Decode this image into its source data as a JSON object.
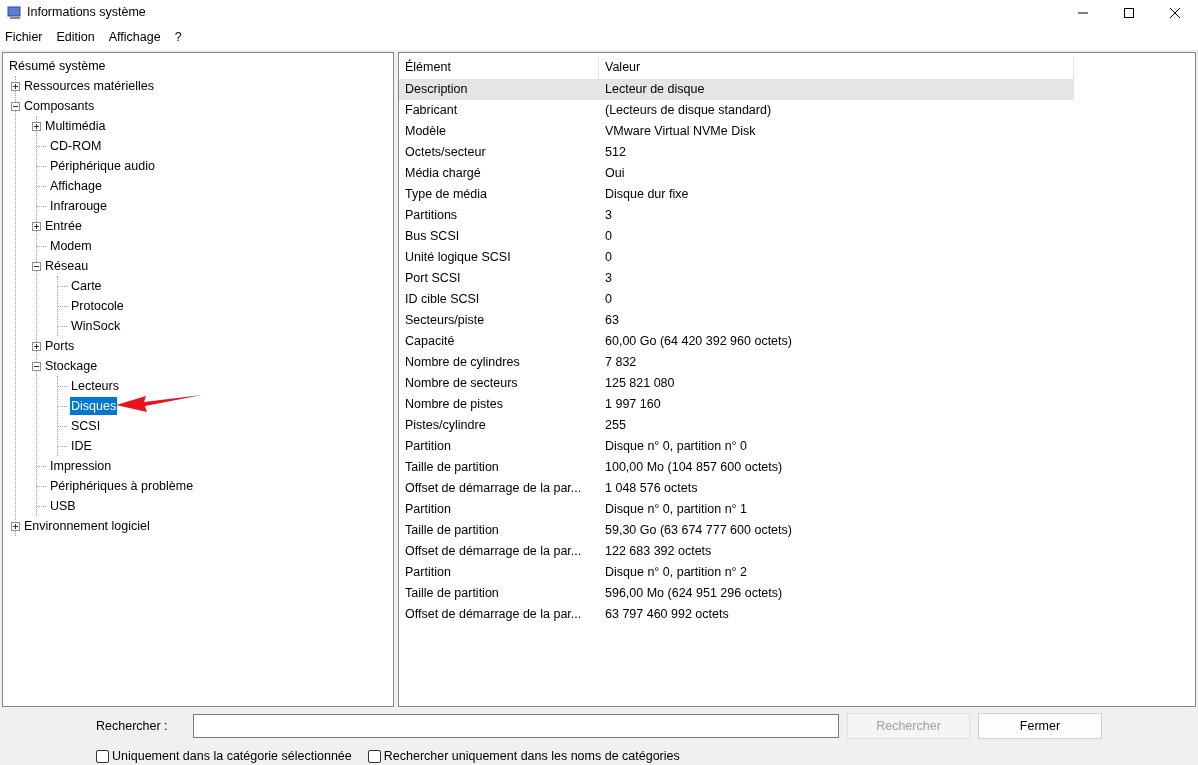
{
  "window": {
    "title": "Informations système"
  },
  "menu": [
    "Fichier",
    "Edition",
    "Affichage",
    "?"
  ],
  "tree": [
    {
      "label": "Résumé système",
      "selected": false,
      "children": [
        {
          "label": "Ressources matérielles",
          "selected": false,
          "expanded": false
        },
        {
          "label": "Composants",
          "selected": false,
          "expanded": true,
          "children": [
            {
              "label": "Multimédia",
              "selected": false,
              "expanded": false
            },
            {
              "label": "CD-ROM",
              "selected": false
            },
            {
              "label": "Périphérique audio",
              "selected": false
            },
            {
              "label": "Affichage",
              "selected": false
            },
            {
              "label": "Infrarouge",
              "selected": false
            },
            {
              "label": "Entrée",
              "selected": false,
              "expanded": false
            },
            {
              "label": "Modem",
              "selected": false
            },
            {
              "label": "Réseau",
              "selected": false,
              "expanded": true,
              "children": [
                {
                  "label": "Carte",
                  "selected": false
                },
                {
                  "label": "Protocole",
                  "selected": false
                },
                {
                  "label": "WinSock",
                  "selected": false
                }
              ]
            },
            {
              "label": "Ports",
              "selected": false,
              "expanded": false
            },
            {
              "label": "Stockage",
              "selected": false,
              "expanded": true,
              "children": [
                {
                  "label": "Lecteurs",
                  "selected": false
                },
                {
                  "label": "Disques",
                  "selected": true
                },
                {
                  "label": "SCSI",
                  "selected": false
                },
                {
                  "label": "IDE",
                  "selected": false
                }
              ]
            },
            {
              "label": "Impression",
              "selected": false
            },
            {
              "label": "Périphériques à problème",
              "selected": false
            },
            {
              "label": "USB",
              "selected": false
            }
          ]
        },
        {
          "label": "Environnement logiciel",
          "selected": false,
          "expanded": false
        }
      ]
    }
  ],
  "table": {
    "columns": [
      "Élément",
      "Valeur"
    ],
    "rows": [
      {
        "cells": [
          "Description",
          "Lecteur de disque"
        ],
        "selected": true
      },
      {
        "cells": [
          "Fabricant",
          "(Lecteurs de disque standard)"
        ],
        "selected": false
      },
      {
        "cells": [
          "Modèle",
          "VMware Virtual NVMe Disk"
        ],
        "selected": false
      },
      {
        "cells": [
          "Octets/secteur",
          "512"
        ],
        "selected": false
      },
      {
        "cells": [
          "Média chargé",
          "Oui"
        ],
        "selected": false
      },
      {
        "cells": [
          "Type de média",
          "Disque dur fixe"
        ],
        "selected": false
      },
      {
        "cells": [
          "Partitions",
          "3"
        ],
        "selected": false
      },
      {
        "cells": [
          "Bus SCSI",
          "0"
        ],
        "selected": false
      },
      {
        "cells": [
          "Unité logique SCSI",
          "0"
        ],
        "selected": false
      },
      {
        "cells": [
          "Port SCSI",
          "3"
        ],
        "selected": false
      },
      {
        "cells": [
          "ID cible SCSI",
          "0"
        ],
        "selected": false
      },
      {
        "cells": [
          "Secteurs/piste",
          "63"
        ],
        "selected": false
      },
      {
        "cells": [
          "Capacité",
          "60,00 Go (64 420 392 960 octets)"
        ],
        "selected": false
      },
      {
        "cells": [
          "Nombre de cylindres",
          "7 832"
        ],
        "selected": false
      },
      {
        "cells": [
          "Nombre de secteurs",
          "125 821 080"
        ],
        "selected": false
      },
      {
        "cells": [
          "Nombre de pistes",
          "1 997 160"
        ],
        "selected": false
      },
      {
        "cells": [
          "Pistes/cylindre",
          "255"
        ],
        "selected": false
      },
      {
        "cells": [
          "Partition",
          "Disque n° 0, partition n° 0"
        ],
        "selected": false
      },
      {
        "cells": [
          "Taille de partition",
          "100,00 Mo (104 857 600 octets)"
        ],
        "selected": false
      },
      {
        "cells": [
          "Offset de démarrage de la par...",
          "1 048 576 octets"
        ],
        "selected": false
      },
      {
        "cells": [
          "Partition",
          "Disque n° 0, partition n° 1"
        ],
        "selected": false
      },
      {
        "cells": [
          "Taille de partition",
          "59,30 Go (63 674 777 600 octets)"
        ],
        "selected": false
      },
      {
        "cells": [
          "Offset de démarrage de la par...",
          "122 683 392 octets"
        ],
        "selected": false
      },
      {
        "cells": [
          "Partition",
          "Disque n° 0, partition n° 2"
        ],
        "selected": false
      },
      {
        "cells": [
          "Taille de partition",
          "596,00 Mo (624 951 296 octets)"
        ],
        "selected": false
      },
      {
        "cells": [
          "Offset de démarrage de la par...",
          "63 797 460 992 octets"
        ],
        "selected": false
      }
    ]
  },
  "search": {
    "label": "Rechercher :",
    "search_button": {
      "label": "Rechercher",
      "disabled": true
    },
    "close_button": {
      "label": "Fermer",
      "disabled": false
    },
    "options": [
      {
        "label": "Uniquement dans la catégorie sélectionnée",
        "checked": false
      },
      {
        "label": "Rechercher uniquement dans les noms de catégories",
        "checked": false
      }
    ]
  }
}
